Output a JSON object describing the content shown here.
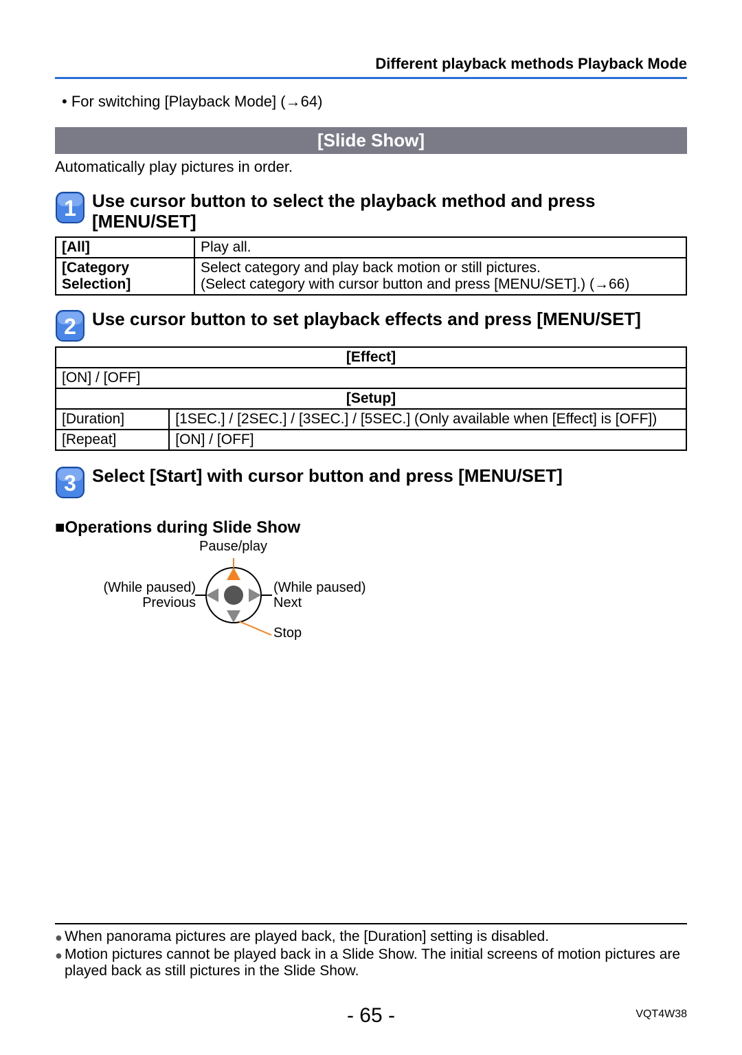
{
  "header": {
    "breadcrumb": "Different playback methods  Playback Mode"
  },
  "intro": {
    "switch_note": "• For switching [Playback Mode] (→64)"
  },
  "section": {
    "title": "[Slide Show]",
    "desc": "Automatically play pictures in order."
  },
  "steps": [
    {
      "num": "1",
      "title": "Use cursor button to select the playback method and press [MENU/SET]"
    },
    {
      "num": "2",
      "title": "Use cursor button to set playback effects and press [MENU/SET]"
    },
    {
      "num": "3",
      "title": "Select [Start] with cursor button and press [MENU/SET]"
    }
  ],
  "table1": {
    "rows": [
      {
        "label": "[All]",
        "value": "Play all."
      },
      {
        "label": "[Category Selection]",
        "value": "Select category and play back motion or still pictures.\n(Select category with cursor button and press [MENU/SET].) (→66)"
      }
    ]
  },
  "table2": {
    "effect_header": "[Effect]",
    "effect_value": "[ON] / [OFF]",
    "setup_header": "[Setup]",
    "rows": [
      {
        "label": "[Duration]",
        "value": "[1SEC.] / [2SEC.] / [3SEC.] / [5SEC.] (Only available when [Effect] is [OFF])"
      },
      {
        "label": "[Repeat]",
        "value": "[ON] / [OFF]"
      }
    ]
  },
  "ops": {
    "heading": "■Operations during Slide Show",
    "top": "Pause/play",
    "left1": "(While paused)",
    "left2": "Previous",
    "right1": "(While paused)",
    "right2": "Next",
    "bottom": "Stop"
  },
  "notes": [
    "When panorama pictures are played back, the [Duration] setting is disabled.",
    "Motion pictures cannot be played back in a Slide Show. The initial screens of motion pictures are played back as still pictures in the Slide Show."
  ],
  "footer": {
    "page": "- 65 -",
    "code": "VQT4W38"
  }
}
